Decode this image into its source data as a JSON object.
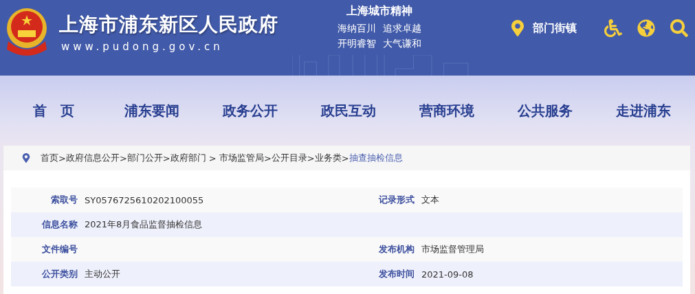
{
  "header": {
    "title": "上海市浦东新区人民政府",
    "url": "www.pudong.gov.cn",
    "motto_title": "上海城市精神",
    "motto_lines": [
      "海纳百川",
      "追求卓越",
      "开明睿智",
      "大气谦和"
    ],
    "location_link": "部门街镇"
  },
  "nav": [
    "首　页",
    "浦东要闻",
    "政务公开",
    "政民互动",
    "营商环境",
    "公共服务",
    "走进浦东"
  ],
  "breadcrumb": {
    "items": [
      {
        "label": "首页",
        "current": false
      },
      {
        "label": "政府信息公开",
        "current": false
      },
      {
        "label": "部门公开",
        "current": false
      },
      {
        "label": "政府部门",
        "current": false
      },
      {
        "label": "市场监管局",
        "current": false
      },
      {
        "label": "公开目录",
        "current": false
      },
      {
        "label": "业务类",
        "current": false
      },
      {
        "label": "抽查抽检信息",
        "current": true
      }
    ],
    "separators": [
      ">",
      ">",
      ">",
      " > ",
      ">",
      ">",
      ">"
    ]
  },
  "info_rows": [
    {
      "cells": [
        {
          "label": "索取号",
          "value": "SY0576725610202100055"
        },
        {
          "label": "记录形式",
          "value": "文本"
        }
      ]
    },
    {
      "cells": [
        {
          "label": "信息名称",
          "value": "2021年8月食品监督抽检信息"
        }
      ]
    },
    {
      "cells": [
        {
          "label": "文件编号"
        },
        {
          "label": "发布机构",
          "value": "市场监督管理局"
        }
      ]
    },
    {
      "cells": [
        {
          "label": "公开类别",
          "value": "主动公开"
        },
        {
          "label": "发布时间",
          "value": "2021-09-08"
        }
      ]
    }
  ]
}
